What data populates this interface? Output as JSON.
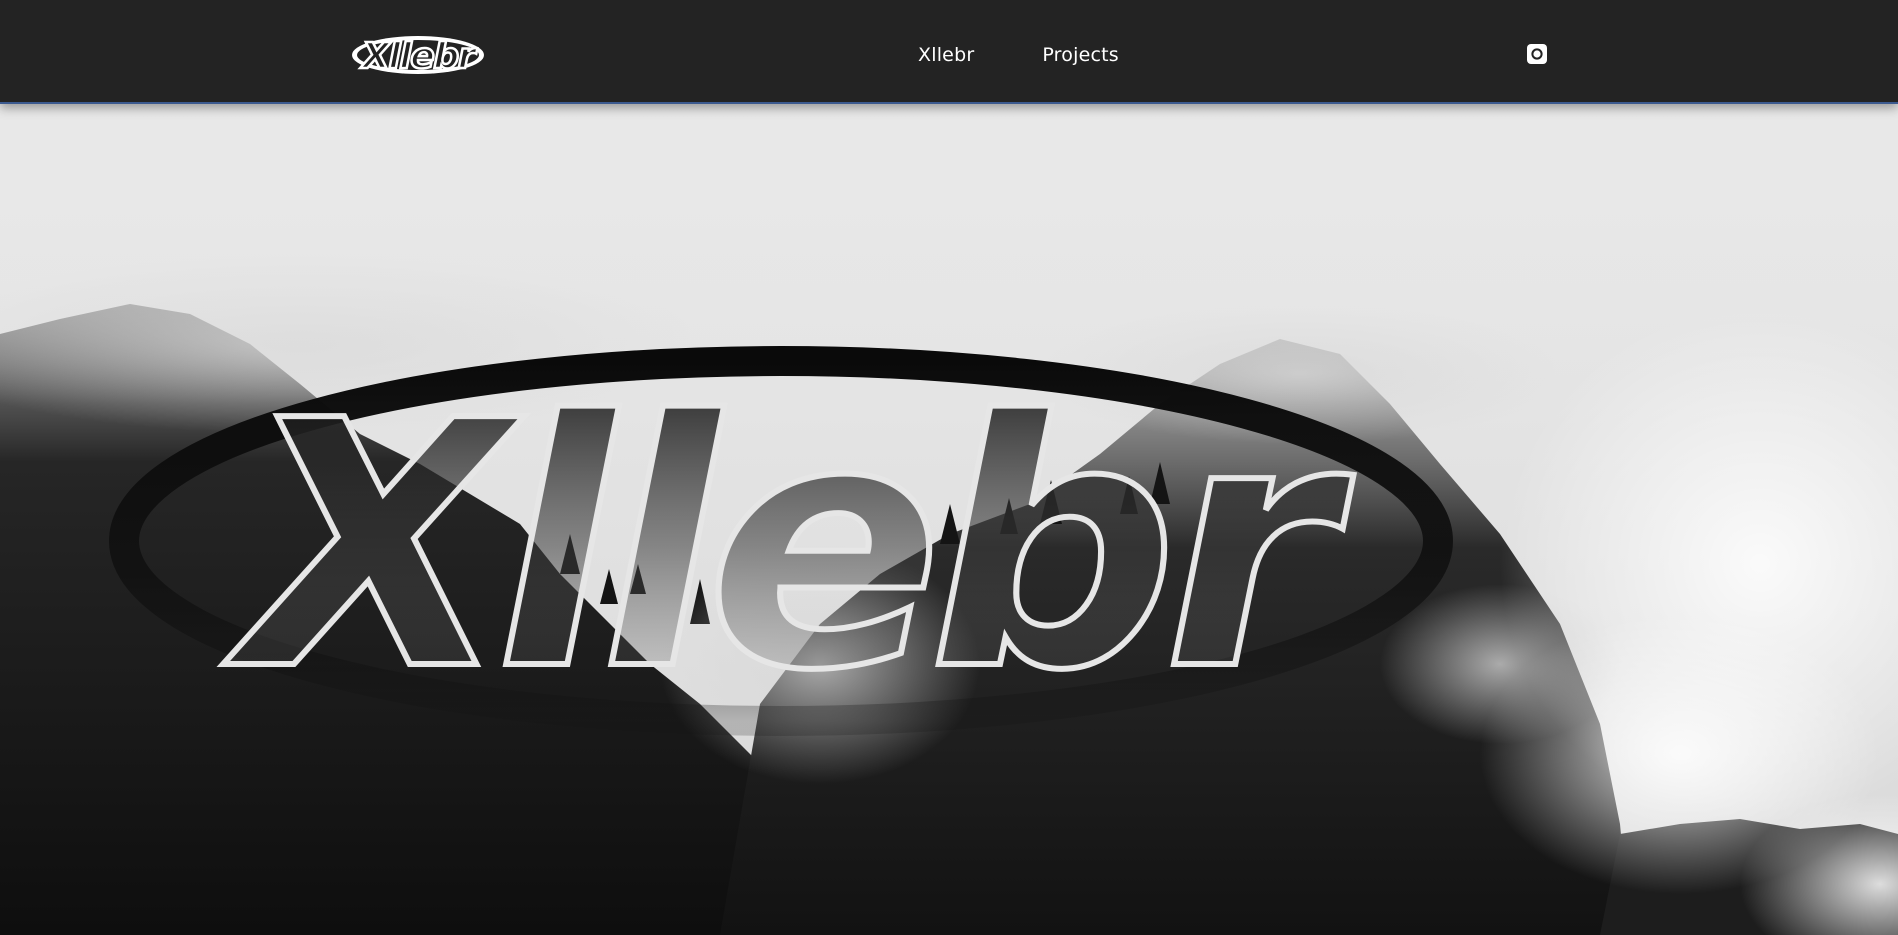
{
  "header": {
    "logo": {
      "text": "Xllebr",
      "icon": "xllebr-logo"
    },
    "nav": [
      {
        "label": "Xllebr"
      },
      {
        "label": "Projects"
      }
    ],
    "social_icon": "instagram-icon",
    "accent": "#3c5a8f",
    "background": "#232323"
  },
  "hero": {
    "logo_text": "Xllebr",
    "background_image": "foggy-mountain-cliffs",
    "sky_color": "#e8e8e8",
    "rock_color": "#161616"
  }
}
